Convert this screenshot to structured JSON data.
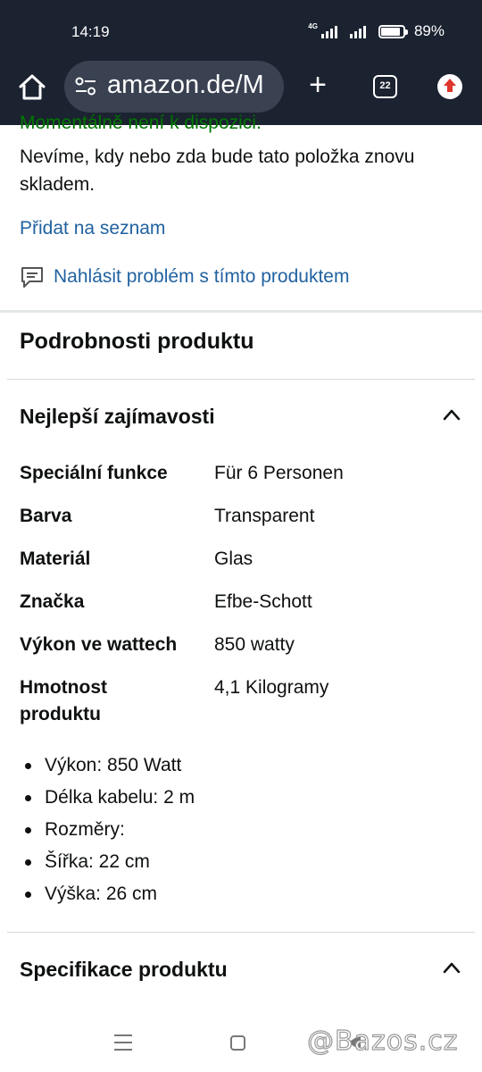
{
  "status_bar": {
    "time": "14:19",
    "network": "4G",
    "battery_percent": "89%",
    "battery_level": 0.89
  },
  "browser": {
    "url": "amazon.de/M",
    "tab_count": "22",
    "icons": [
      "home-icon",
      "site-settings-icon",
      "new-tab-icon",
      "tab-switcher-icon",
      "update-icon"
    ]
  },
  "availability": {
    "status_partial": "Momentálně není k dispozici.",
    "message": "Nevíme, kdy nebo zda bude tato položka znovu skladem.",
    "color": "#007600"
  },
  "actions": {
    "add_to_list": "Přidat na seznam",
    "report_problem": "Nahlásit problém s tímto produktem",
    "link_color": "#2162a1"
  },
  "product_details": {
    "title": "Podrobnosti produktu",
    "highlights": {
      "title": "Nejlepší zajímavosti",
      "rows": [
        {
          "key": "Speciální funkce",
          "value": "Für 6 Personen"
        },
        {
          "key": "Barva",
          "value": "Transparent"
        },
        {
          "key": "Materiál",
          "value": "Glas"
        },
        {
          "key": "Značka",
          "value": "Efbe-Schott"
        },
        {
          "key": "Výkon ve wattech",
          "value": "850 watty"
        },
        {
          "key": "Hmotnost produktu",
          "value": "4,1 Kilogramy"
        }
      ],
      "bullets": [
        "Výkon: 850 Watt",
        "Délka kabelu: 2 m",
        "Rozměry:",
        "Šířka: 22 cm",
        "Výška: 26 cm"
      ]
    },
    "specifications": {
      "title": "Specifikace produktu"
    }
  },
  "watermark": "@Bazos.cz"
}
